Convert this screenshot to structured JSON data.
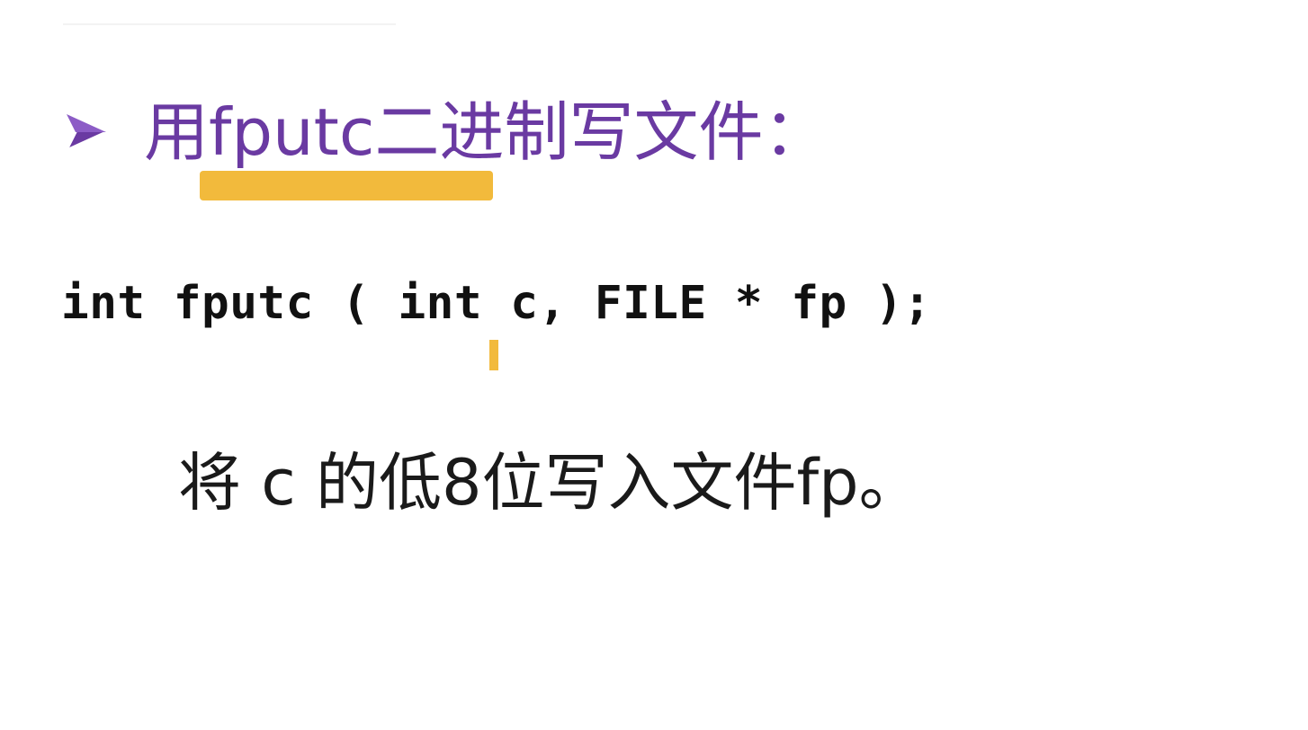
{
  "slide": {
    "heading": {
      "text": "用fputc二进制写文件：",
      "color": "#6a3aa2",
      "bullet_icon": "arrowhead-bullet-icon"
    },
    "annotation_color": "#f2ba3c",
    "code": "int fputc ( int c, FILE * fp );",
    "description": "将 c 的低8位写入文件fp。"
  }
}
